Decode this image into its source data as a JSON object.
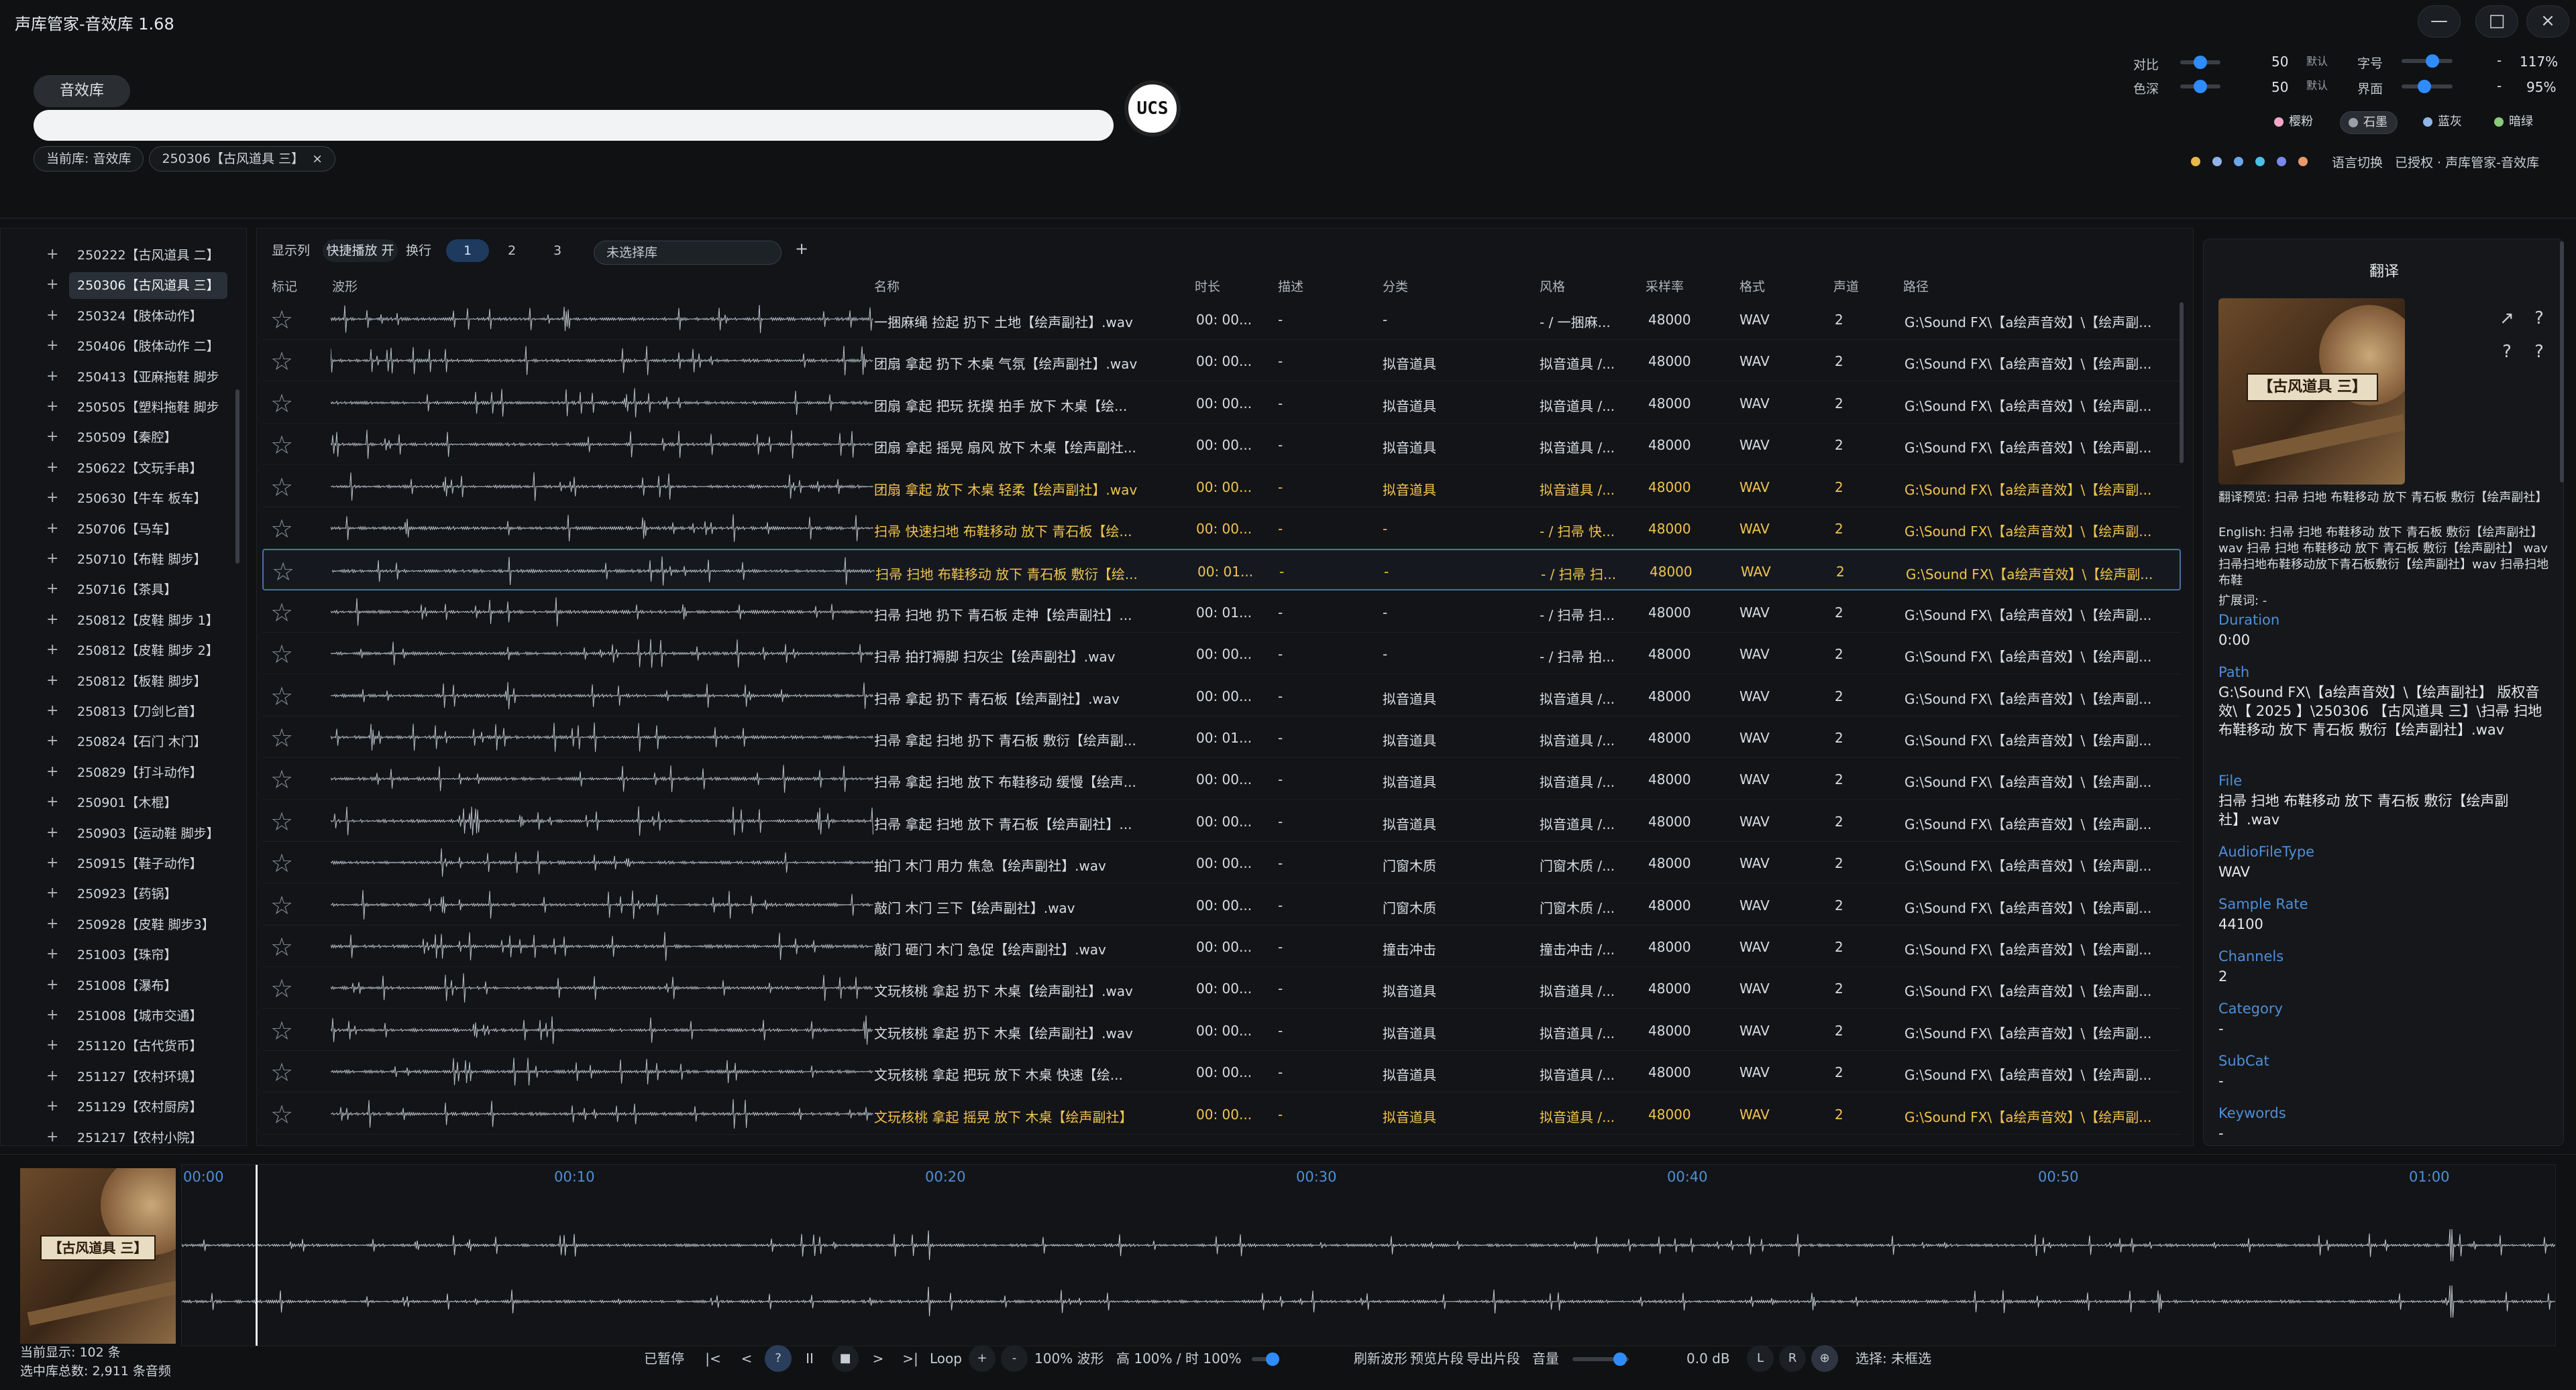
{
  "app": {
    "title": "声库管家-音效库  1.68"
  },
  "window_controls": {
    "minimize": "—",
    "maximize": "□",
    "close": "×"
  },
  "header": {
    "library_tab": "音效库",
    "chips": [
      "当前库: 音效库",
      "250306【古风道具 三】",
      "×"
    ],
    "ucs_label": "UCS"
  },
  "settings": {
    "contrast": {
      "label": "对比",
      "value": "50",
      "default": "默认",
      "level": 0.5
    },
    "saturation": {
      "label": "色深",
      "value": "50",
      "default": "默认",
      "level": 0.5
    },
    "font_size": {
      "label": "字号",
      "value": "117%",
      "minus": "-",
      "level": 0.6
    },
    "ui_scale": {
      "label": "界面",
      "value": "95%",
      "minus": "-",
      "level": 0.45
    },
    "themes": [
      {
        "label": "樱粉",
        "color": "#f2a6c8"
      },
      {
        "label": "石墨",
        "color": "#9aa0a6"
      },
      {
        "label": "蓝灰",
        "color": "#8fb4e6"
      },
      {
        "label": "暗绿",
        "color": "#8cc97a"
      }
    ],
    "swatches": [
      "#e8b94a",
      "#8fb4e6",
      "#6aa8e8",
      "#4ac0e8",
      "#7a8ae8",
      "#e89a6a"
    ],
    "language": "语言切换",
    "license": "已授权 · 声库管家-音效库"
  },
  "sidebar": {
    "items": [
      {
        "label": "250222【古风道具 二】",
        "selected": false
      },
      {
        "label": "250306【古风道具 三】",
        "selected": true
      },
      {
        "label": "250324【肢体动作】",
        "selected": false
      },
      {
        "label": "250406【肢体动作 二】",
        "selected": false
      },
      {
        "label": "250413【亚麻拖鞋 脚步",
        "selected": false
      },
      {
        "label": "250505【塑料拖鞋 脚步",
        "selected": false
      },
      {
        "label": "250509【秦腔】",
        "selected": false
      },
      {
        "label": "250622【文玩手串】",
        "selected": false
      },
      {
        "label": "250630【牛车 板车】",
        "selected": false
      },
      {
        "label": "250706【马车】",
        "selected": false
      },
      {
        "label": "250710【布鞋 脚步】",
        "selected": false
      },
      {
        "label": "250716【茶具】",
        "selected": false
      },
      {
        "label": "250812【皮鞋 脚步 1】",
        "selected": false
      },
      {
        "label": "250812【皮鞋 脚步 2】",
        "selected": false
      },
      {
        "label": "250812【板鞋 脚步】",
        "selected": false
      },
      {
        "label": "250813【刀剑匕首】",
        "selected": false
      },
      {
        "label": "250824【石门 木门】",
        "selected": false
      },
      {
        "label": "250829【打斗动作】",
        "selected": false
      },
      {
        "label": "250901【木棍】",
        "selected": false
      },
      {
        "label": "250903【运动鞋 脚步】",
        "selected": false
      },
      {
        "label": "250915【鞋子动作】",
        "selected": false
      },
      {
        "label": "250923【药锅】",
        "selected": false
      },
      {
        "label": "250928【皮鞋 脚步3】",
        "selected": false
      },
      {
        "label": "251003【珠帘】",
        "selected": false
      },
      {
        "label": "251008【瀑布】",
        "selected": false
      },
      {
        "label": "251008【城市交通】",
        "selected": false
      },
      {
        "label": "251120【古代货币】",
        "selected": false
      },
      {
        "label": "251127【农村环境】",
        "selected": false
      },
      {
        "label": "251129【农村厨房】",
        "selected": false
      },
      {
        "label": "251217【农村小院】",
        "selected": false
      }
    ]
  },
  "toolbar": {
    "show_cols": "显示列",
    "quick_play": "快捷播放 开",
    "wrap": "换行",
    "pages": [
      "1",
      "2",
      "3"
    ],
    "library_select": "未选择库",
    "add": "+"
  },
  "table": {
    "columns": [
      "标记",
      "波形",
      "名称",
      "时长",
      "描述",
      "分类",
      "风格",
      "采样率",
      "格式",
      "声道",
      "路径"
    ],
    "rows": [
      {
        "name": "一捆麻绳 捡起 扔下 土地【绘声副社】.wav",
        "duration": "00: 00...",
        "desc": "-",
        "category": "-",
        "style": "- / 一捆麻...",
        "rate": "48000",
        "format": "WAV",
        "channels": "2",
        "path": "G:\\Sound FX\\【a绘声音效】\\【绘声副...",
        "hl": false,
        "sel": false
      },
      {
        "name": "团扇 拿起 扔下 木桌 气氛【绘声副社】.wav",
        "duration": "00: 00...",
        "desc": "-",
        "category": "拟音道具",
        "style": "拟音道具 /...",
        "rate": "48000",
        "format": "WAV",
        "channels": "2",
        "path": "G:\\Sound FX\\【a绘声音效】\\【绘声副...",
        "hl": false,
        "sel": false
      },
      {
        "name": "团扇 拿起 把玩 抚摸 拍手 放下 木桌【绘...",
        "duration": "00: 00...",
        "desc": "-",
        "category": "拟音道具",
        "style": "拟音道具 /...",
        "rate": "48000",
        "format": "WAV",
        "channels": "2",
        "path": "G:\\Sound FX\\【a绘声音效】\\【绘声副...",
        "hl": false,
        "sel": false
      },
      {
        "name": "团扇 拿起 摇晃 扇风 放下 木桌【绘声副社...",
        "duration": "00: 00...",
        "desc": "-",
        "category": "拟音道具",
        "style": "拟音道具 /...",
        "rate": "48000",
        "format": "WAV",
        "channels": "2",
        "path": "G:\\Sound FX\\【a绘声音效】\\【绘声副...",
        "hl": false,
        "sel": false
      },
      {
        "name": "团扇 拿起 放下 木桌 轻柔【绘声副社】.wav",
        "duration": "00: 00...",
        "desc": "-",
        "category": "拟音道具",
        "style": "拟音道具 /...",
        "rate": "48000",
        "format": "WAV",
        "channels": "2",
        "path": "G:\\Sound FX\\【a绘声音效】\\【绘声副...",
        "hl": true,
        "sel": false
      },
      {
        "name": "扫帚 快速扫地 布鞋移动 放下 青石板【绘...",
        "duration": "00: 00...",
        "desc": "-",
        "category": "-",
        "style": "- / 扫帚 快...",
        "rate": "48000",
        "format": "WAV",
        "channels": "2",
        "path": "G:\\Sound FX\\【a绘声音效】\\【绘声副...",
        "hl": true,
        "sel": false
      },
      {
        "name": "扫帚 扫地 布鞋移动 放下 青石板 敷衍【绘...",
        "duration": "00: 01...",
        "desc": "-",
        "category": "-",
        "style": "- / 扫帚 扫...",
        "rate": "48000",
        "format": "WAV",
        "channels": "2",
        "path": "G:\\Sound FX\\【a绘声音效】\\【绘声副...",
        "hl": true,
        "sel": true
      },
      {
        "name": "扫帚 扫地 扔下 青石板 走神【绘声副社】...",
        "duration": "00: 01...",
        "desc": "-",
        "category": "-",
        "style": "- / 扫帚 扫...",
        "rate": "48000",
        "format": "WAV",
        "channels": "2",
        "path": "G:\\Sound FX\\【a绘声音效】\\【绘声副...",
        "hl": false,
        "sel": false
      },
      {
        "name": "扫帚 拍打褥脚 扫灰尘【绘声副社】.wav",
        "duration": "00: 00...",
        "desc": "-",
        "category": "-",
        "style": "- / 扫帚 拍...",
        "rate": "48000",
        "format": "WAV",
        "channels": "2",
        "path": "G:\\Sound FX\\【a绘声音效】\\【绘声副...",
        "hl": false,
        "sel": false
      },
      {
        "name": "扫帚 拿起 扔下 青石板【绘声副社】.wav",
        "duration": "00: 00...",
        "desc": "-",
        "category": "拟音道具",
        "style": "拟音道具 /...",
        "rate": "48000",
        "format": "WAV",
        "channels": "2",
        "path": "G:\\Sound FX\\【a绘声音效】\\【绘声副...",
        "hl": false,
        "sel": false
      },
      {
        "name": "扫帚 拿起 扫地 扔下 青石板 敷衍【绘声副...",
        "duration": "00: 01...",
        "desc": "-",
        "category": "拟音道具",
        "style": "拟音道具 /...",
        "rate": "48000",
        "format": "WAV",
        "channels": "2",
        "path": "G:\\Sound FX\\【a绘声音效】\\【绘声副...",
        "hl": false,
        "sel": false
      },
      {
        "name": "扫帚 拿起 扫地 放下 布鞋移动 缓慢【绘声...",
        "duration": "00: 00...",
        "desc": "-",
        "category": "拟音道具",
        "style": "拟音道具 /...",
        "rate": "48000",
        "format": "WAV",
        "channels": "2",
        "path": "G:\\Sound FX\\【a绘声音效】\\【绘声副...",
        "hl": false,
        "sel": false
      },
      {
        "name": "扫帚 拿起 扫地 放下 青石板【绘声副社】...",
        "duration": "00: 00...",
        "desc": "-",
        "category": "拟音道具",
        "style": "拟音道具 /...",
        "rate": "48000",
        "format": "WAV",
        "channels": "2",
        "path": "G:\\Sound FX\\【a绘声音效】\\【绘声副...",
        "hl": false,
        "sel": false
      },
      {
        "name": "拍门 木门 用力 焦急【绘声副社】.wav",
        "duration": "00: 00...",
        "desc": "-",
        "category": "门窗木质",
        "style": "门窗木质 /...",
        "rate": "48000",
        "format": "WAV",
        "channels": "2",
        "path": "G:\\Sound FX\\【a绘声音效】\\【绘声副...",
        "hl": false,
        "sel": false
      },
      {
        "name": "敲门 木门 三下【绘声副社】.wav",
        "duration": "00: 00...",
        "desc": "-",
        "category": "门窗木质",
        "style": "门窗木质 /...",
        "rate": "48000",
        "format": "WAV",
        "channels": "2",
        "path": "G:\\Sound FX\\【a绘声音效】\\【绘声副...",
        "hl": false,
        "sel": false
      },
      {
        "name": "敲门 砸门 木门 急促【绘声副社】.wav",
        "duration": "00: 00...",
        "desc": "-",
        "category": "撞击冲击",
        "style": "撞击冲击 /...",
        "rate": "48000",
        "format": "WAV",
        "channels": "2",
        "path": "G:\\Sound FX\\【a绘声音效】\\【绘声副...",
        "hl": false,
        "sel": false
      },
      {
        "name": "文玩核桃 拿起 扔下 木桌【绘声副社】.wav",
        "duration": "00: 00...",
        "desc": "-",
        "category": "拟音道具",
        "style": "拟音道具 /...",
        "rate": "48000",
        "format": "WAV",
        "channels": "2",
        "path": "G:\\Sound FX\\【a绘声音效】\\【绘声副...",
        "hl": false,
        "sel": false
      },
      {
        "name": "文玩核桃 拿起 扔下 木桌【绘声副社】.wav",
        "duration": "00: 00...",
        "desc": "-",
        "category": "拟音道具",
        "style": "拟音道具 /...",
        "rate": "48000",
        "format": "WAV",
        "channels": "2",
        "path": "G:\\Sound FX\\【a绘声音效】\\【绘声副...",
        "hl": false,
        "sel": false
      },
      {
        "name": "文玩核桃 拿起 把玩 放下 木桌 快速【绘...",
        "duration": "00: 00...",
        "desc": "-",
        "category": "拟音道具",
        "style": "拟音道具 /...",
        "rate": "48000",
        "format": "WAV",
        "channels": "2",
        "path": "G:\\Sound FX\\【a绘声音效】\\【绘声副...",
        "hl": false,
        "sel": false
      },
      {
        "name": "文玩核桃 拿起 摇晃 放下 木桌【绘声副社】",
        "duration": "00: 00...",
        "desc": "-",
        "category": "拟音道具",
        "style": "拟音道具 /...",
        "rate": "48000",
        "format": "WAV",
        "channels": "2",
        "path": "G:\\Sound FX\\【a绘声音效】\\【绘声副...",
        "hl": true,
        "sel": false
      }
    ]
  },
  "details": {
    "title": "翻译",
    "cover_label": "【古风道具 三】",
    "icons": {
      "open": "↗",
      "help1": "?",
      "help2": "?",
      "help3": "?"
    },
    "translate_preview": "翻译预览: 扫帚 扫地 布鞋移动 放下 青石板 敷衍【绘声副社】",
    "english": "English: 扫帚 扫地 布鞋移动 放下 青石板 敷衍【绘声副社】 wav 扫帚 扫地 布鞋移动 放下 青石板 敷衍【绘声副社】 wav 扫帚扫地布鞋移动放下青石板敷衍【绘声副社】wav 扫帚扫地布鞋",
    "ext_words": "扩展词: -",
    "fields": [
      {
        "key": "Duration",
        "value": "0:00"
      },
      {
        "key": "Path",
        "value": "G:\\Sound FX\\【a绘声音效】\\【绘声副社】 版权音效\\【 2025 】\\250306 【古风道具 三】\\扫帚 扫地 布鞋移动 放下 青石板 敷衍【绘声副社】.wav"
      },
      {
        "key": "File",
        "value": "扫帚 扫地 布鞋移动 放下 青石板 敷衍【绘声副社】.wav"
      },
      {
        "key": "AudioFileType",
        "value": "WAV"
      },
      {
        "key": "Sample Rate",
        "value": "44100"
      },
      {
        "key": "Channels",
        "value": "2"
      },
      {
        "key": "Category",
        "value": "-"
      },
      {
        "key": "SubCat",
        "value": "-"
      },
      {
        "key": "Keywords",
        "value": "-"
      }
    ]
  },
  "player": {
    "cover_label": "【古风道具 三】",
    "ticks": [
      "00:00",
      "00:10",
      "00:20",
      "00:30",
      "00:40",
      "00:50",
      "01:00"
    ],
    "showing": "当前显示:  102 条",
    "total": "选中库总数:  2,911 条音频",
    "status": "已暂停",
    "btn_first": "|<",
    "btn_prev": "<",
    "btn_help": "?",
    "btn_pause": "II",
    "btn_stop": "■",
    "btn_next": ">",
    "btn_last": ">|",
    "loop": "Loop",
    "plus": "+",
    "minus": "-",
    "zoom": "100%  波形",
    "height": "高 100% / 时 100%",
    "refresh": "刷新波形",
    "preview": "预览片段",
    "export": "导出片段",
    "volume_label": "音量",
    "volume_level": 0.85,
    "db": "0.0 dB",
    "left": "L",
    "right": "R",
    "mono": "⊕",
    "selection": "选择: 未框选"
  }
}
